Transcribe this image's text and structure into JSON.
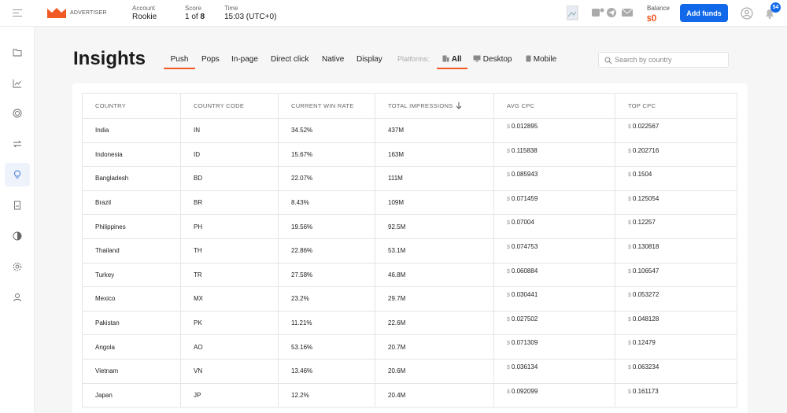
{
  "brand": "ADVERTISER",
  "account": {
    "label": "Account",
    "value": "Rookie"
  },
  "score": {
    "label": "Score",
    "current": "1",
    "of": "of",
    "total": "8"
  },
  "time": {
    "label": "Time",
    "value": "15:03 (UTC+0)"
  },
  "balance": {
    "label": "Balance",
    "currency": "$",
    "value": "0"
  },
  "add_funds": "Add funds",
  "notifications_count": "54",
  "page_title": "Insights",
  "tabs": [
    "Push",
    "Pops",
    "In-page",
    "Direct click",
    "Native",
    "Display"
  ],
  "platforms_label": "Platforms:",
  "platforms": [
    "All",
    "Desktop",
    "Mobile"
  ],
  "search_placeholder": "Search by country",
  "columns": [
    "COUNTRY",
    "COUNTRY CODE",
    "CURRENT WIN RATE",
    "TOTAL IMPRESSIONS",
    "AVG CPC",
    "TOP CPC"
  ],
  "currency_symbol": "$",
  "rows": [
    [
      "India",
      "IN",
      "34.52%",
      "437M",
      "0.012895",
      "0.022567"
    ],
    [
      "Indonesia",
      "ID",
      "15.67%",
      "163M",
      "0.115838",
      "0.202716"
    ],
    [
      "Bangladesh",
      "BD",
      "22.07%",
      "111M",
      "0.085943",
      "0.1504"
    ],
    [
      "Brazil",
      "BR",
      "8.43%",
      "109M",
      "0.071459",
      "0.125054"
    ],
    [
      "Philippines",
      "PH",
      "19.56%",
      "92.5M",
      "0.07004",
      "0.12257"
    ],
    [
      "Thailand",
      "TH",
      "22.86%",
      "53.1M",
      "0.074753",
      "0.130818"
    ],
    [
      "Turkey",
      "TR",
      "27.58%",
      "46.8M",
      "0.060884",
      "0.106547"
    ],
    [
      "Mexico",
      "MX",
      "23.2%",
      "29.7M",
      "0.030441",
      "0.053272"
    ],
    [
      "Pakistan",
      "PK",
      "11.21%",
      "22.6M",
      "0.027502",
      "0.048128"
    ],
    [
      "Angola",
      "AO",
      "53.16%",
      "20.7M",
      "0.071309",
      "0.12479"
    ],
    [
      "Vietnam",
      "VN",
      "13.46%",
      "20.6M",
      "0.036134",
      "0.063234"
    ],
    [
      "Japan",
      "JP",
      "12.2%",
      "20.4M",
      "0.092099",
      "0.161173"
    ]
  ],
  "colors": {
    "accent": "#f15a24",
    "primary": "#1168e8"
  }
}
